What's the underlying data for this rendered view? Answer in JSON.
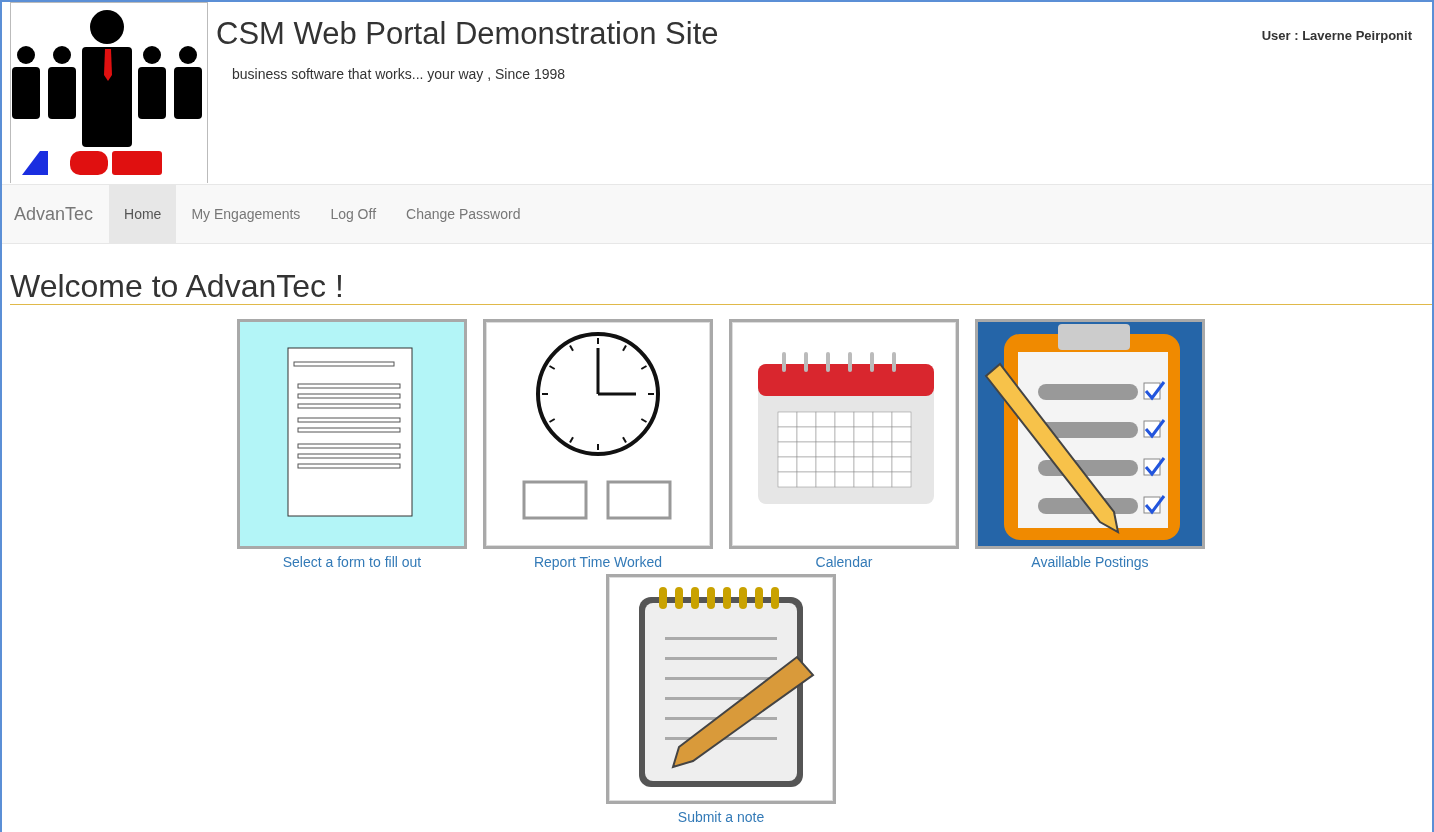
{
  "header": {
    "title": "CSM Web Portal Demonstration Site",
    "tagline": "business software that works... your way , Since 1998",
    "user": "User : Laverne Peirponit"
  },
  "navbar": {
    "brand": "AdvanTec",
    "items": [
      {
        "label": "Home",
        "selected": true
      },
      {
        "label": "My Engagements",
        "selected": false
      },
      {
        "label": "Log Off",
        "selected": false
      },
      {
        "label": "Change Password",
        "selected": false
      }
    ]
  },
  "heading": "Welcome to AdvanTec !",
  "tiles": [
    {
      "kind": "form",
      "label": "Select a form to fill out"
    },
    {
      "kind": "clock",
      "label": "Report Time Worked"
    },
    {
      "kind": "calendar",
      "label": "Calendar"
    },
    {
      "kind": "checklist",
      "label": "Availlable Postings"
    },
    {
      "kind": "notepad",
      "label": "Submit a note"
    }
  ]
}
